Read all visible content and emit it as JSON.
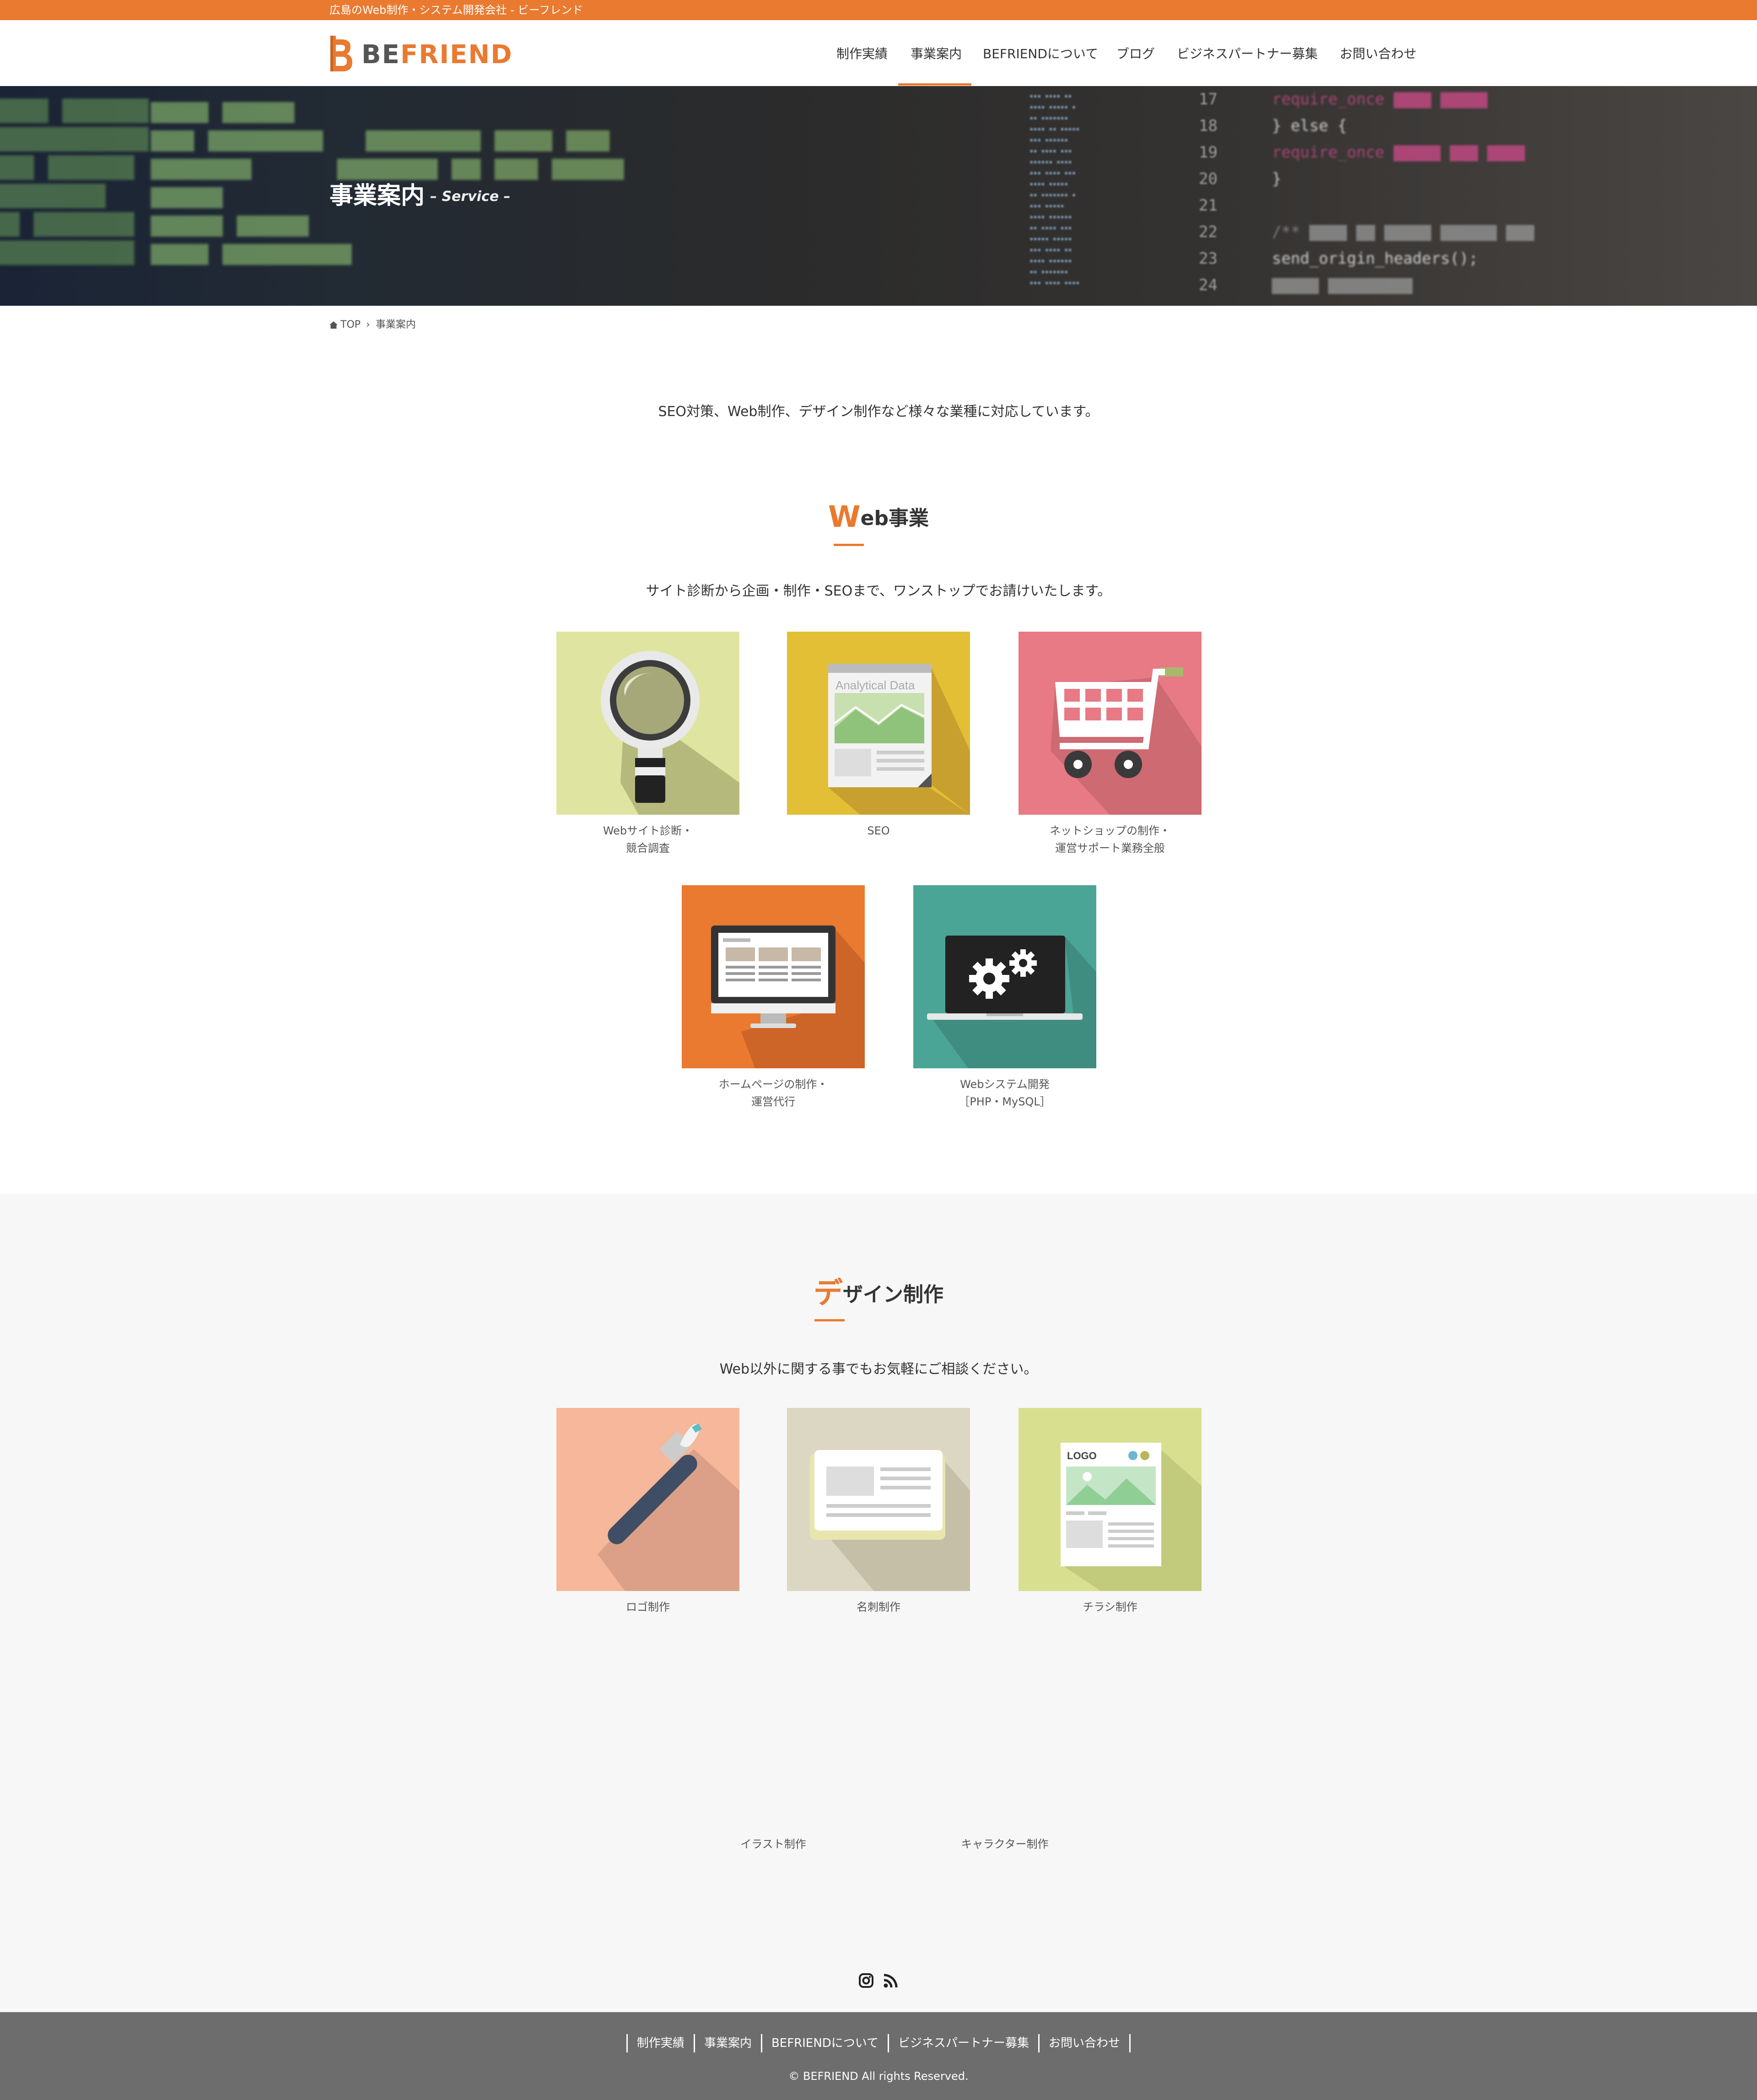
{
  "topbar": {
    "tagline": "広島のWeb制作・システム開発会社 - ビーフレンド"
  },
  "header": {
    "logo_be": "BE",
    "logo_friend": "FRIEND",
    "nav": [
      "制作実績",
      "事業案内",
      "BEFRIENDについて",
      "ブログ",
      "ビジネスパートナー募集",
      "お問い合わせ"
    ],
    "active_nav": "事業案内"
  },
  "hero": {
    "title": "事業案内",
    "subtitle": "– Service –"
  },
  "breadcrumb": {
    "home": "TOP",
    "current": "事業案内"
  },
  "intro": "SEO対策、Web制作、デザイン制作など様々な業種に対応しています。",
  "web": {
    "title_first": "W",
    "title_rest": "eb事業",
    "lead": "サイト診断から企画・制作・SEOまで、ワンストップでお請けいたします。",
    "cards": [
      {
        "line1": "Webサイト診断・",
        "line2": "競合調査",
        "icon": "magnifier-icon",
        "color": "#dfe5a0"
      },
      {
        "line1": "SEO",
        "line2": "",
        "icon": "analytics-document-icon",
        "color": "#e2bf34"
      },
      {
        "line1": "ネットショップの制作・",
        "line2": "運営サポート業務全般",
        "icon": "shopping-cart-icon",
        "color": "#e77a84"
      },
      {
        "line1": "ホームページの制作・",
        "line2": "運営代行",
        "icon": "desktop-monitor-icon",
        "color": "#e97a30"
      },
      {
        "line1": "Webシステム開発",
        "line2": "［PHP・MySQL］",
        "icon": "laptop-gears-icon",
        "color": "#4aa596"
      }
    ],
    "analytics_label": "Analytical Data"
  },
  "design": {
    "title_first": "デ",
    "title_rest": "ザイン制作",
    "lead": "Web以外に関する事でもお気軽にご相談ください。",
    "cards": [
      {
        "line1": "ロゴ制作",
        "icon": "paintbrush-icon",
        "color": "#f6b79a"
      },
      {
        "line1": "名刺制作",
        "icon": "business-card-icon",
        "color": "#dcd7c2"
      },
      {
        "line1": "チラシ制作",
        "icon": "flyer-icon",
        "color": "#d8e08f"
      }
    ],
    "extra": [
      "イラスト制作",
      "キャラクター制作"
    ],
    "flyer_logo": "LOGO"
  },
  "social": {
    "icons": [
      "instagram-icon",
      "rss-icon"
    ]
  },
  "footer": {
    "nav": [
      "制作実績",
      "事業案内",
      "BEFRIENDについて",
      "ビジネスパートナー募集",
      "お問い合わせ"
    ],
    "copyright": "© BEFRIEND All rights Reserved."
  },
  "colors": {
    "accent": "#e97a30",
    "footer": "#6d6d6d",
    "light_bg": "#f7f7f7"
  }
}
